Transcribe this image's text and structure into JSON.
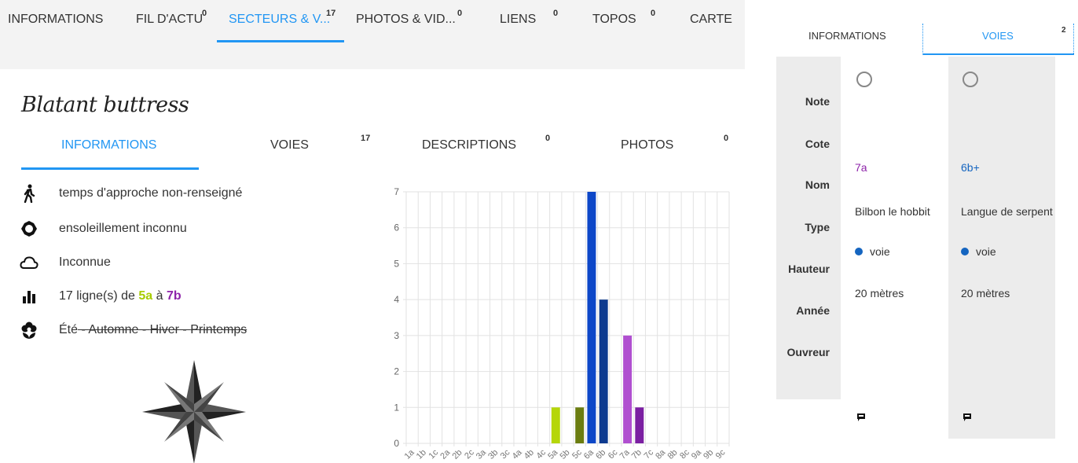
{
  "nav": {
    "tabs": [
      {
        "label": "INFORMATIONS",
        "count": ""
      },
      {
        "label": "FIL D'ACTU",
        "count": "0"
      },
      {
        "label": "SECTEURS & V...",
        "count": "17"
      },
      {
        "label": "PHOTOS & VID...",
        "count": "0"
      },
      {
        "label": "LIENS",
        "count": "0"
      },
      {
        "label": "TOPOS",
        "count": "0"
      },
      {
        "label": "CARTE",
        "count": ""
      }
    ],
    "active": "SECTEURS & V..."
  },
  "sector": {
    "title": "Blatant buttress",
    "subtabs": [
      {
        "label": "INFORMATIONS",
        "count": ""
      },
      {
        "label": "VOIES",
        "count": "17"
      },
      {
        "label": "DESCRIPTIONS",
        "count": "0"
      },
      {
        "label": "PHOTOS",
        "count": "0"
      }
    ],
    "info": {
      "approach": "temps d'approche non-renseigné",
      "sun": "ensoleillement inconnu",
      "weather": "Inconnue",
      "lines_prefix": "17 ligne(s) de",
      "lines_from": "5a",
      "lines_mid": "à",
      "lines_to": "7b",
      "season_1": "Été",
      "season_sep": " - ",
      "season_2": "Automne",
      "season_3": "Hiver",
      "season_4": "Printemps"
    },
    "icons": {
      "approach": "walking-person-icon",
      "sun": "sun-icon",
      "weather": "cloud-icon",
      "lines": "bar-chart-icon",
      "season": "flower-icon",
      "orientation": "compass-rose-icon"
    }
  },
  "chart_data": {
    "type": "bar",
    "categories": [
      "1a",
      "1b",
      "1c",
      "2a",
      "2b",
      "2c",
      "3a",
      "3b",
      "3c",
      "4a",
      "4b",
      "4c",
      "5a",
      "5b",
      "5c",
      "6a",
      "6b",
      "6c",
      "7a",
      "7b",
      "7c",
      "8a",
      "8b",
      "8c",
      "9a",
      "9b",
      "9c"
    ],
    "values": [
      0,
      0,
      0,
      0,
      0,
      0,
      0,
      0,
      0,
      0,
      0,
      0,
      1,
      0,
      1,
      7,
      4,
      0,
      3,
      1,
      0,
      0,
      0,
      0,
      0,
      0,
      0
    ],
    "colors": [
      "#cccccc",
      "#cccccc",
      "#cccccc",
      "#cccccc",
      "#cccccc",
      "#cccccc",
      "#cccccc",
      "#cccccc",
      "#cccccc",
      "#cccccc",
      "#cccccc",
      "#cccccc",
      "#b5d60a",
      "#8a9a0a",
      "#6b7d10",
      "#0d47c8",
      "#0d3a8f",
      "#0d3a8f",
      "#b04fd0",
      "#7b1fa2",
      "#7b1fa2",
      "#cccccc",
      "#cccccc",
      "#cccccc",
      "#cccccc",
      "#cccccc",
      "#cccccc"
    ],
    "yticks": [
      0,
      1,
      2,
      3,
      4,
      5,
      6,
      7
    ],
    "ylim": [
      0,
      7
    ],
    "grid": true,
    "xlabel": "",
    "ylabel": "",
    "title": ""
  },
  "panel": {
    "tabs": [
      {
        "label": "INFORMATIONS",
        "count": ""
      },
      {
        "label": "VOIES",
        "count": "2"
      }
    ],
    "labels": [
      "Note",
      "Cote",
      "Nom",
      "Type",
      "Hauteur",
      "Année",
      "Ouvreur"
    ],
    "routes": [
      {
        "cote": "7a",
        "nom": "Bilbon le hobbit",
        "type": "voie",
        "hauteur": "20 mètres"
      },
      {
        "cote": "6b+",
        "nom": "Langue de serpent",
        "type": "voie",
        "hauteur": "20 mètres"
      }
    ],
    "colors": {
      "accent": "#2196f3",
      "cote_purple": "#8e24aa",
      "cote_blue": "#1565c0"
    }
  }
}
